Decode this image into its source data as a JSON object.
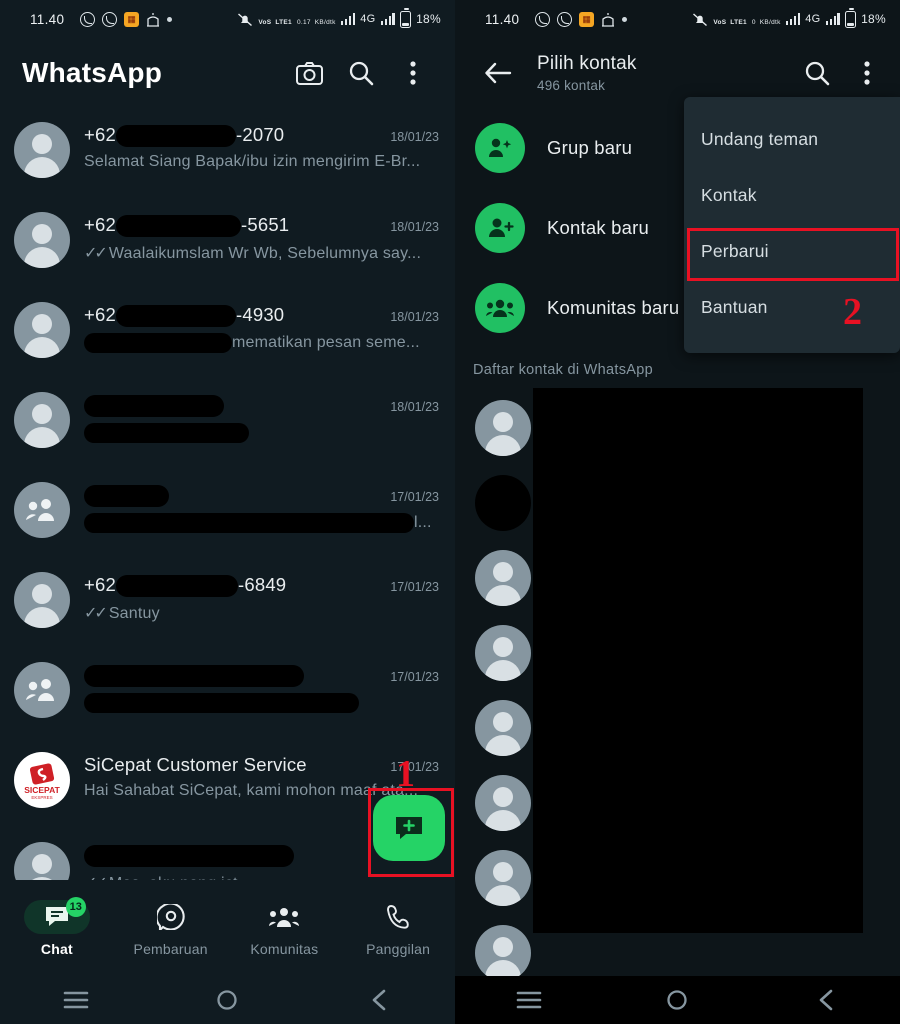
{
  "status_bar": {
    "time": "11.40",
    "left_icons": [
      "whatsapp-icon",
      "whatsapp-icon",
      "orange-app-icon",
      "mosque-icon",
      "dot-icon"
    ],
    "mute_icon": "bell-off-icon",
    "volte_label_top": "VoS",
    "volte_label_bottom": "LTE1",
    "data_rate_value": "0.17",
    "data_rate_unit": "KB/dtk",
    "network_type": "4G",
    "battery_percent": "18%"
  },
  "left_panel": {
    "app_title": "WhatsApp",
    "actions": [
      {
        "name": "camera-icon",
        "label": "Kamera"
      },
      {
        "name": "search-icon",
        "label": "Cari"
      },
      {
        "name": "overflow-menu-icon",
        "label": "Opsi lainnya"
      }
    ],
    "chats": [
      {
        "name": "+62",
        "name_suffix": "-2070",
        "redact_name_width": 120,
        "message": "Selamat Siang Bapak/ibu izin mengirim  E-Br...",
        "time": "18/01/23",
        "avatar": "person",
        "ticks": false,
        "redact_msg_width": 0
      },
      {
        "name": "+62",
        "name_suffix": "-5651",
        "redact_name_width": 125,
        "message": "Waalaikumslam Wr Wb,  Sebelumnya say...",
        "time": "18/01/23",
        "avatar": "person",
        "ticks": true,
        "redact_msg_width": 0
      },
      {
        "name": "+62",
        "name_suffix": "-4930",
        "redact_name_width": 120,
        "message": "mematikan pesan seme...",
        "time": "18/01/23",
        "avatar": "person",
        "ticks": false,
        "redact_msg_width": 148
      },
      {
        "name": "",
        "name_suffix": "",
        "redact_name_width": 140,
        "message": "",
        "time": "18/01/23",
        "avatar": "person",
        "ticks": false,
        "redact_msg_width": 165
      },
      {
        "name": "",
        "name_suffix": "",
        "redact_name_width": 85,
        "message": "l...",
        "time": "17/01/23",
        "avatar": "group",
        "ticks": false,
        "redact_msg_width": 330
      },
      {
        "name": "+62",
        "name_suffix": "-6849",
        "redact_name_width": 122,
        "message": "Santuy",
        "time": "17/01/23",
        "avatar": "person",
        "ticks": true,
        "redact_msg_width": 0
      },
      {
        "name": "",
        "name_suffix": "",
        "redact_name_width": 220,
        "message": "",
        "time": "17/01/23",
        "avatar": "group",
        "ticks": false,
        "redact_msg_width": 275
      },
      {
        "name": "SiCepat Customer Service",
        "name_suffix": "",
        "redact_name_width": 0,
        "message": "Hai Sahabat SiCepat, kami mohon maaf ata...",
        "time": "17/01/23",
        "avatar": "sicepat",
        "ticks": false,
        "redact_msg_width": 0
      },
      {
        "name": "",
        "name_suffix": "",
        "redact_name_width": 210,
        "message": "Mas, aku nang ict",
        "time": "",
        "avatar": "person",
        "ticks": true,
        "redact_msg_width": 0
      }
    ],
    "fab": {
      "name": "new-chat-fab",
      "icon": "new-message-icon"
    },
    "bottom_nav": [
      {
        "label": "Chat",
        "icon": "chat-icon",
        "active": true,
        "badge": "13"
      },
      {
        "label": "Pembaruan",
        "icon": "updates-icon",
        "active": false,
        "badge": ""
      },
      {
        "label": "Komunitas",
        "icon": "communities-icon",
        "active": false,
        "badge": ""
      },
      {
        "label": "Panggilan",
        "icon": "calls-icon",
        "active": false,
        "badge": ""
      }
    ]
  },
  "right_panel": {
    "back_label": "Kembali",
    "title": "Pilih kontak",
    "subtitle": "496 kontak",
    "search_label": "Cari",
    "overflow_label": "Opsi lainnya",
    "actions": [
      {
        "label": "Grup baru",
        "icon": "new-group-icon"
      },
      {
        "label": "Kontak baru",
        "icon": "new-contact-icon"
      },
      {
        "label": "Komunitas baru",
        "icon": "new-community-icon"
      }
    ],
    "section_header": "Daftar kontak di WhatsApp",
    "contact_rows": 8,
    "menu": {
      "items": [
        {
          "label": "Undang teman",
          "highlighted": false
        },
        {
          "label": "Kontak",
          "highlighted": false
        },
        {
          "label": "Perbarui",
          "highlighted": true
        },
        {
          "label": "Bantuan",
          "highlighted": false
        }
      ]
    }
  },
  "annotations": [
    {
      "number": "1",
      "target": "new-chat-fab"
    },
    {
      "number": "2",
      "target": "menu-item-perbarui"
    }
  ],
  "system_nav": [
    {
      "icon": "recents-icon",
      "label": "Aplikasi terbaru"
    },
    {
      "icon": "home-icon",
      "label": "Beranda"
    },
    {
      "icon": "back-icon",
      "label": "Kembali"
    }
  ],
  "colors": {
    "background": "#101b21",
    "accent_green": "#25d366",
    "annotation_red": "#e81123",
    "text_primary": "#e9edef",
    "text_secondary": "#8696a0"
  }
}
